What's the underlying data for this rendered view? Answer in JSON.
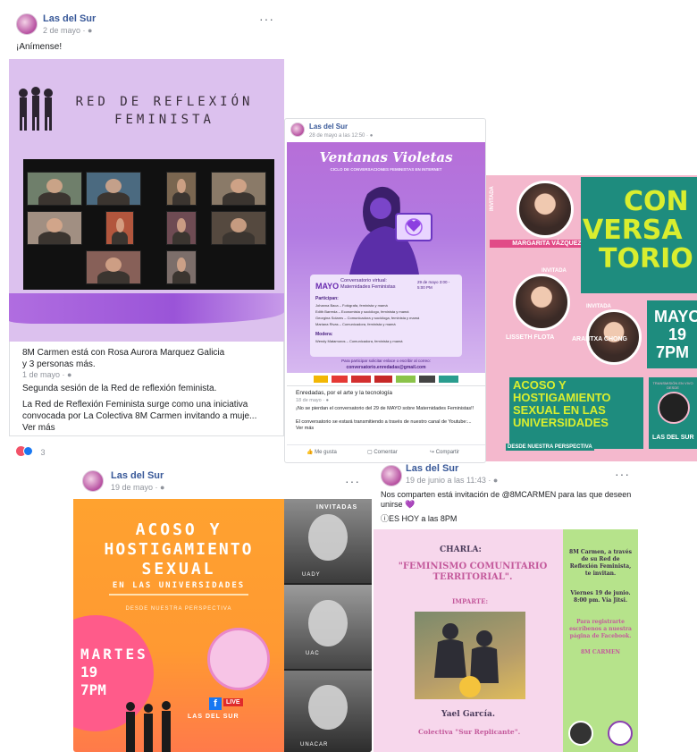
{
  "post1": {
    "author": "Las del Sur",
    "date": "2 de mayo · ",
    "text": "¡Anímense!",
    "image_title": "RED DE REFLEXIÓN FEMINISTA",
    "shared_header": "8M Carmen está con Rosa Aurora Marquez Galicia y 3 personas más.",
    "shared_date": "1 de mayo · ",
    "shared_line1": "Segunda sesión de la Red de reflexión feminista.",
    "shared_line2": "La Red de Reflexión Feminista surge como una iniciativa convocada por La Colectiva 8M Carmen invitando a muje... Ver más",
    "reactions_count": "3"
  },
  "post2": {
    "author": "Las del Sur",
    "date": "28 de mayo a las 12:50 · ",
    "poster_title": "Ventanas Violetas",
    "poster_subtitle": "CICLO DE CONVERSACIONES FEMINISTAS EN INTERNET",
    "month": "MAYO",
    "event_label": "Conversatorio virtual: Maternidades Feministas",
    "event_time": "29 de mayo 3:00 - 5:00 PM",
    "participants_label": "Participan:",
    "participants": [
      "Johanna Baca – Fotógrafa, feminista y mamá",
      "Edith Barreda – Economista y sociólogo, feminista y mamá",
      "Georgina Solares – Comunicadora y socióloga, feminista y mamá",
      "Mariana Rivas – Comunicadora, feminista y mamá"
    ],
    "moderator_label": "Modera:",
    "moderator": "Wendy Matamoros – Comunicadora, feminista y mamá",
    "contact_line": "Para participar solicitar enlace o escribir al correo:",
    "contact_email": "conversatorio.enredadas@gmail.com",
    "page_name": "Enredadas, por el arte y la tecnología",
    "page_date": "18 de mayo · ",
    "desc1": "¡No se pierdan el conversatorio del 29 de MAYO sobre Maternidades Feministas!!",
    "desc2": "El conversatorio se estará transmitiendo a través de nuestro canal de Youtube:... Ver más",
    "like": "Me gusta",
    "comment": "Comentar",
    "share": "Compartir"
  },
  "post3": {
    "title_lines": [
      "CON",
      "VERSA",
      "TORIO"
    ],
    "invited_label": "INVITADA",
    "guest1": "MARGARITA VÁZQUEZ",
    "guest2": "LISSETH FLOTA",
    "guest3": "ARANTXA CHONG",
    "date_lines": [
      "MAYO",
      "19",
      "7PM"
    ],
    "topic_lines": [
      "ACOSO Y",
      "HOSTIGAMIENTO",
      "SEXUAL EN LAS",
      "UNIVERSIDADES"
    ],
    "perspective": "DESDE NUESTRA PERSPECTIVA",
    "broadcast": "TRANSMISIÓN EN VIVO DESDE",
    "brand": "LAS DEL SUR"
  },
  "post4": {
    "author": "Las del Sur",
    "date": "19 de mayo · ",
    "title1": "ACOSO Y",
    "title2": "HOSTIGAMIENTO",
    "title3": "SEXUAL",
    "title4": "EN LAS UNIVERSIDADES",
    "perspective": "DESDE NUESTRA PERSPECTIVA",
    "day": "MARTES",
    "num": "19",
    "time": "7PM",
    "live": "LIVE",
    "brand": "LAS DEL SUR",
    "invited": "INVITADAS",
    "labels": [
      "UADY",
      "UAC",
      "UNACAR"
    ]
  },
  "post5": {
    "author": "Las del Sur",
    "date": "19 de junio a las 11:43 · ",
    "line1": "Nos comparten está invitación de @8MCARMEN para las que deseen unirse 💜",
    "line2": "ⓘES HOY a las 8PM",
    "charla": "CHARLA:",
    "topic": "\"FEMINISMO COMUNITARIO TERRITORIAL\".",
    "imparte": "IMPARTE:",
    "speaker": "Yael García.",
    "collective": "Colectiva \"Sur Replicante\".",
    "side1": "8M Carmen, a través de su Red de Reflexión Feminista, te invitan.",
    "side2": "Viernes 19 de junio. 8:00 pm. Vía Jitsi.",
    "side3": "Para registrarte escríbenos a nuestra página de Facebook.",
    "side4": "8M CARMEN"
  },
  "colors": {
    "fb_link": "#385898",
    "lilac": "#d7b6ea",
    "purple": "#8e4fd0",
    "teal": "#1e8c7e",
    "yellow_green": "#d9ee2f",
    "orange": "#ffa22f",
    "green_side": "#b6e38b"
  }
}
